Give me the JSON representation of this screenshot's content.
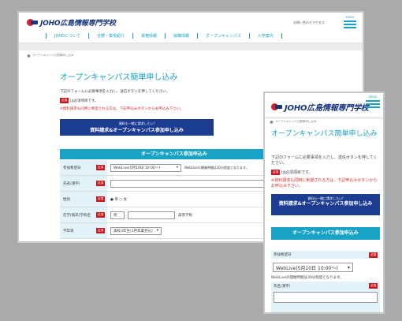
{
  "brand": {
    "logo_text": "JOHO広島情報専門学校",
    "accent": "#17a2c6",
    "navy": "#1b3c90",
    "red": "#c91c22"
  },
  "header": {
    "util_links": [
      "お問い合わせ",
      "アクセス"
    ],
    "menu_label": "MENU",
    "nav": [
      "JOHOについて",
      "分野・専攻紹介",
      "資格情報",
      "就職情報",
      "オープンキャンパス",
      "入学案内"
    ]
  },
  "breadcrumb": {
    "icon": "home-icon",
    "text": "オープンキャンパス簡単申し込み"
  },
  "page": {
    "title": "オープンキャンパス簡単申し込み",
    "intro": "下記のフォームに必要事項を入力し、送信ボタンを押してください。",
    "required_badge": "必須",
    "required_text": "は必須項目です。",
    "warning": "※資料請求も同時に希望される方は、下記申込みボタンからお申込み下さい。",
    "button_small": "資料も一緒に請求したい!",
    "button_main": "資料請求&オープンキャンパス参加申し込み",
    "form_title": "オープンキャンパス参加申込み"
  },
  "form": {
    "rows": [
      {
        "label": "参加希望日",
        "value": "WebLive(5月10日 10:00〜)",
        "note": "WebLiveの開催時間は30分程度となります。"
      },
      {
        "label": "氏名(漢字)",
        "value": "",
        "note": ""
      },
      {
        "label": "性別",
        "value": "男 ○ 女",
        "note": ""
      },
      {
        "label": "在学(既卒)学校名",
        "value": "県",
        "note": "高等学校"
      },
      {
        "label": "学年等",
        "value": "高校3年生(1月卒業見込)",
        "note": ""
      }
    ]
  },
  "mobile": {
    "date_label": "参加希望日",
    "date_value": "WebLive(5月10日 10:00〜)",
    "date_note": "WebLiveの開催時間は30分程度となります。",
    "name_label": "氏名(漢字)"
  }
}
